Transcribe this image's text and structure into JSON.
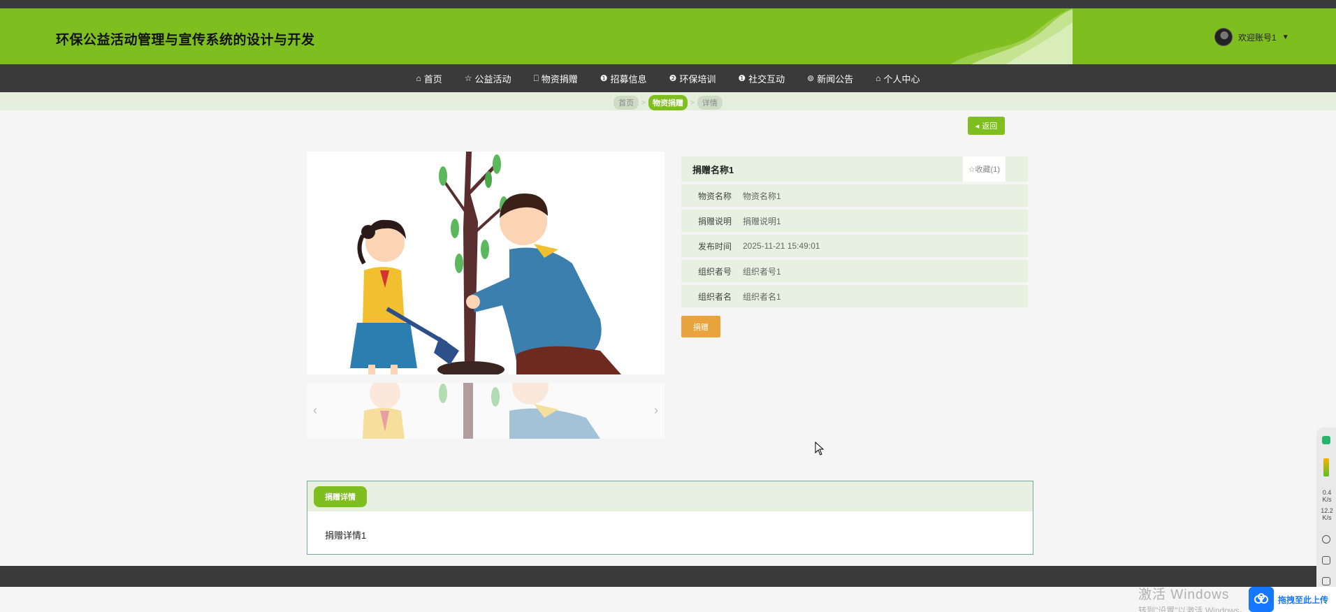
{
  "app": {
    "title": "环保公益活动管理与宣传系统的设计与开发"
  },
  "user": {
    "welcome": "欢迎账号1",
    "caret": "▼"
  },
  "nav": [
    {
      "icon": "home-icon",
      "glyph": "⌂",
      "label": "首页"
    },
    {
      "icon": "star-icon",
      "glyph": "☆",
      "label": "公益活动"
    },
    {
      "icon": "bag-icon",
      "glyph": "⎕",
      "label": "物资捐赠"
    },
    {
      "icon": "info-icon",
      "glyph": "❶",
      "label": "招募信息"
    },
    {
      "icon": "question-icon",
      "glyph": "❷",
      "label": "环保培训"
    },
    {
      "icon": "info-icon",
      "glyph": "❶",
      "label": "社交互动"
    },
    {
      "icon": "settings-icon",
      "glyph": "⊚",
      "label": "新闻公告"
    },
    {
      "icon": "home-icon",
      "glyph": "⌂",
      "label": "个人中心"
    }
  ],
  "breadcrumb": {
    "home": "首页",
    "section": "物资捐赠",
    "current": "详情",
    "sep": ">"
  },
  "back_label": "返回",
  "item": {
    "title": "捐赠名称1",
    "favorite": "☆收藏(1)",
    "fields": [
      {
        "label": "物资名称",
        "value": "物资名称1"
      },
      {
        "label": "捐赠说明",
        "value": "捐赠说明1"
      },
      {
        "label": "发布时间",
        "value": "2025-11-21 15:49:01"
      },
      {
        "label": "组织者号",
        "value": "组织者号1"
      },
      {
        "label": "组织者名",
        "value": "组织者名1"
      }
    ],
    "donate_label": "捐赠"
  },
  "detail": {
    "tab": "捐赠详情",
    "content": "捐赠详情1"
  },
  "side_widget": {
    "up": "0.4",
    "up_unit": "K/s",
    "down": "12.2",
    "down_unit": "K/s"
  },
  "watermark": {
    "line1": "激活 Windows",
    "line2": "转到\"设置\"以激活 Windows。"
  },
  "upload": {
    "label": "拖拽至此上传"
  },
  "colors": {
    "brand": "#7fbe1f",
    "dark": "#3a3a3a",
    "accent": "#e8a33c"
  }
}
